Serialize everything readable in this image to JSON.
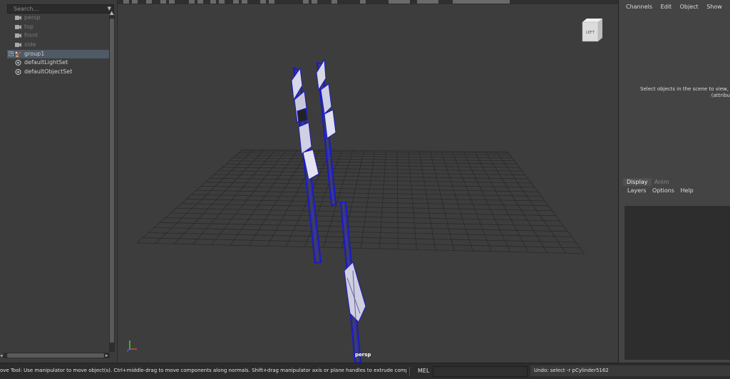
{
  "outliner": {
    "search_placeholder": "Search...",
    "items": [
      {
        "label": "persp",
        "icon": "camera-icon",
        "dim": true
      },
      {
        "label": "top",
        "icon": "camera-icon",
        "dim": true
      },
      {
        "label": "front",
        "icon": "camera-icon",
        "dim": true
      },
      {
        "label": "side",
        "icon": "camera-icon",
        "dim": true
      },
      {
        "label": "group1",
        "icon": "group-transform-icon",
        "dim": false,
        "selected": true
      },
      {
        "label": "defaultLightSet",
        "icon": "set-icon",
        "dim": false
      },
      {
        "label": "defaultObjectSet",
        "icon": "set-icon",
        "dim": false
      }
    ]
  },
  "viewport": {
    "camera_label": "persp",
    "viewcube_label": "LEFT",
    "wire_color": "#1a1ac8",
    "grid_color": "#2a2a2a"
  },
  "channel_box": {
    "menu": [
      "Channels",
      "Edit",
      "Object",
      "Show"
    ],
    "message_line1": "Select objects in the scene to view, e",
    "message_line2": "(attribu"
  },
  "layer_editor": {
    "tabs": [
      "Display",
      "Anim"
    ],
    "menu": [
      "Layers",
      "Options",
      "Help"
    ]
  },
  "status": {
    "help_text": "ove Tool: Use manipulator to move object(s). Ctrl+middle-drag to move components along normals. Shift+drag manipulator axis or plane handles to extrude components or clone objects. Ctrl+Shift+drag to c",
    "mel_label": "MEL",
    "mel_value": "",
    "result_text": "Undo: select -r pCylinder5162"
  }
}
